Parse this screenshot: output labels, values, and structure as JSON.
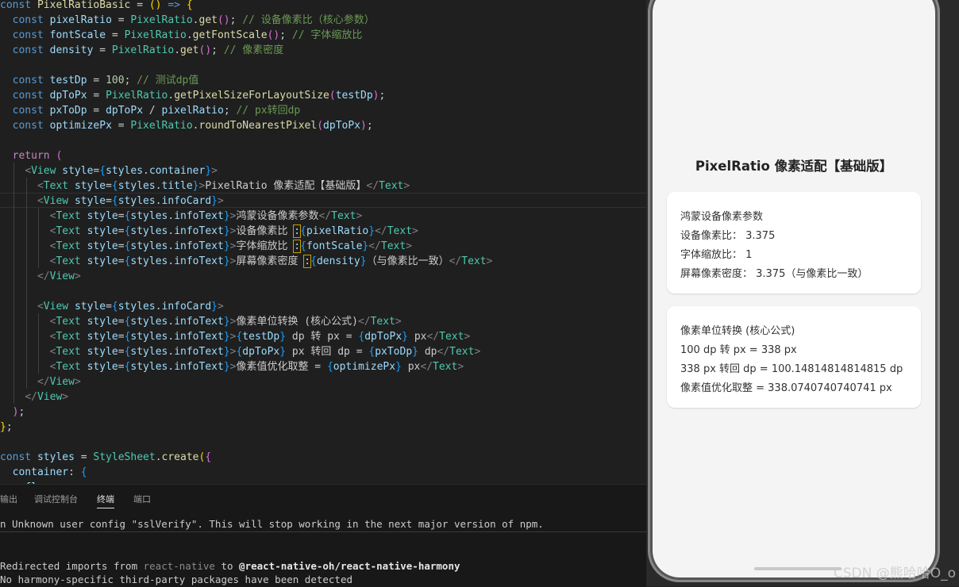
{
  "editor": {
    "lines": [
      [
        [
          "kw",
          "const "
        ],
        [
          "fn",
          "PixelRatioBasic"
        ],
        [
          "str",
          " = "
        ],
        [
          "brace1",
          "() "
        ],
        [
          "kw",
          "=>"
        ],
        [
          "str",
          " "
        ],
        [
          "brace1",
          "{"
        ]
      ],
      [
        [
          "str",
          "  "
        ],
        [
          "kw",
          "const "
        ],
        [
          "var",
          "pixelRatio"
        ],
        [
          "str",
          " = "
        ],
        [
          "cls",
          "PixelRatio"
        ],
        [
          "str",
          "."
        ],
        [
          "fn",
          "get"
        ],
        [
          "brace2",
          "()"
        ],
        [
          "str",
          "; "
        ],
        [
          "cm",
          "// 设备像素比（核心参数）"
        ]
      ],
      [
        [
          "str",
          "  "
        ],
        [
          "kw",
          "const "
        ],
        [
          "var",
          "fontScale"
        ],
        [
          "str",
          " = "
        ],
        [
          "cls",
          "PixelRatio"
        ],
        [
          "str",
          "."
        ],
        [
          "fn",
          "getFontScale"
        ],
        [
          "brace2",
          "()"
        ],
        [
          "str",
          "; "
        ],
        [
          "cm",
          "// 字体缩放比"
        ]
      ],
      [
        [
          "str",
          "  "
        ],
        [
          "kw",
          "const "
        ],
        [
          "var",
          "density"
        ],
        [
          "str",
          " = "
        ],
        [
          "cls",
          "PixelRatio"
        ],
        [
          "str",
          "."
        ],
        [
          "fn",
          "get"
        ],
        [
          "brace2",
          "()"
        ],
        [
          "str",
          "; "
        ],
        [
          "cm",
          "// 像素密度"
        ]
      ],
      [],
      [
        [
          "str",
          "  "
        ],
        [
          "kw",
          "const "
        ],
        [
          "var",
          "testDp"
        ],
        [
          "str",
          " = "
        ],
        [
          "num",
          "100"
        ],
        [
          "str",
          "; "
        ],
        [
          "cm",
          "// 测试dp值"
        ]
      ],
      [
        [
          "str",
          "  "
        ],
        [
          "kw",
          "const "
        ],
        [
          "var",
          "dpToPx"
        ],
        [
          "str",
          " = "
        ],
        [
          "cls",
          "PixelRatio"
        ],
        [
          "str",
          "."
        ],
        [
          "fn",
          "getPixelSizeForLayoutSize"
        ],
        [
          "brace2",
          "("
        ],
        [
          "var",
          "testDp"
        ],
        [
          "brace2",
          ")"
        ],
        [
          "str",
          ";"
        ]
      ],
      [
        [
          "str",
          "  "
        ],
        [
          "kw",
          "const "
        ],
        [
          "var",
          "pxToDp"
        ],
        [
          "str",
          " = "
        ],
        [
          "var",
          "dpToPx"
        ],
        [
          "str",
          " / "
        ],
        [
          "var",
          "pixelRatio"
        ],
        [
          "str",
          "; "
        ],
        [
          "cm",
          "// px转回dp"
        ]
      ],
      [
        [
          "str",
          "  "
        ],
        [
          "kw",
          "const "
        ],
        [
          "var",
          "optimizePx"
        ],
        [
          "str",
          " = "
        ],
        [
          "cls",
          "PixelRatio"
        ],
        [
          "str",
          "."
        ],
        [
          "fn",
          "roundToNearestPixel"
        ],
        [
          "brace2",
          "("
        ],
        [
          "var",
          "dpToPx"
        ],
        [
          "brace2",
          ")"
        ],
        [
          "str",
          ";"
        ]
      ],
      [],
      [
        [
          "str",
          "  "
        ],
        [
          "kw2",
          "return "
        ],
        [
          "brace2",
          "("
        ]
      ],
      [
        [
          "str",
          "    "
        ],
        [
          "tagb",
          "<"
        ],
        [
          "cls",
          "View "
        ],
        [
          "var",
          "style"
        ],
        [
          "str",
          "="
        ],
        [
          "brace3",
          "{"
        ],
        [
          "var",
          "styles"
        ],
        [
          "str",
          "."
        ],
        [
          "var",
          "container"
        ],
        [
          "brace3",
          "}"
        ],
        [
          "tagb",
          ">"
        ]
      ],
      [
        [
          "str",
          "      "
        ],
        [
          "tagb",
          "<"
        ],
        [
          "cls",
          "Text "
        ],
        [
          "var",
          "style"
        ],
        [
          "str",
          "="
        ],
        [
          "brace3",
          "{"
        ],
        [
          "var",
          "styles"
        ],
        [
          "str",
          "."
        ],
        [
          "var",
          "title"
        ],
        [
          "brace3",
          "}"
        ],
        [
          "tagb",
          ">"
        ],
        [
          "str",
          "PixelRatio 像素适配【基础版】"
        ],
        [
          "tagb",
          "</"
        ],
        [
          "cls",
          "Text"
        ],
        [
          "tagb",
          ">"
        ]
      ],
      [
        [
          "str",
          "      "
        ],
        [
          "tagb",
          "<"
        ],
        [
          "cls",
          "View "
        ],
        [
          "var",
          "style"
        ],
        [
          "str",
          "="
        ],
        [
          "brace3",
          "{"
        ],
        [
          "var",
          "styles"
        ],
        [
          "str",
          "."
        ],
        [
          "var",
          "infoCard"
        ],
        [
          "brace3",
          "}"
        ],
        [
          "tagb",
          ">"
        ]
      ],
      [
        [
          "str",
          "        "
        ],
        [
          "tagb",
          "<"
        ],
        [
          "cls",
          "Text "
        ],
        [
          "var",
          "style"
        ],
        [
          "str",
          "="
        ],
        [
          "brace3",
          "{"
        ],
        [
          "var",
          "styles"
        ],
        [
          "str",
          "."
        ],
        [
          "var",
          "infoText"
        ],
        [
          "brace3",
          "}"
        ],
        [
          "tagb",
          ">"
        ],
        [
          "str",
          "鸿蒙设备像素参数"
        ],
        [
          "tagb",
          "</"
        ],
        [
          "cls",
          "Text"
        ],
        [
          "tagb",
          ">"
        ]
      ],
      [
        [
          "str",
          "        "
        ],
        [
          "tagb",
          "<"
        ],
        [
          "cls",
          "Text "
        ],
        [
          "var",
          "style"
        ],
        [
          "str",
          "="
        ],
        [
          "brace3",
          "{"
        ],
        [
          "var",
          "styles"
        ],
        [
          "str",
          "."
        ],
        [
          "var",
          "infoText"
        ],
        [
          "brace3",
          "}"
        ],
        [
          "tagb",
          ">"
        ],
        [
          "str",
          "设备像素比 "
        ],
        [
          "hlc",
          ":"
        ],
        [
          "brace3",
          "{"
        ],
        [
          "var",
          "pixelRatio"
        ],
        [
          "brace3",
          "}"
        ],
        [
          "tagb",
          "</"
        ],
        [
          "cls",
          "Text"
        ],
        [
          "tagb",
          ">"
        ]
      ],
      [
        [
          "str",
          "        "
        ],
        [
          "tagb",
          "<"
        ],
        [
          "cls",
          "Text "
        ],
        [
          "var",
          "style"
        ],
        [
          "str",
          "="
        ],
        [
          "brace3",
          "{"
        ],
        [
          "var",
          "styles"
        ],
        [
          "str",
          "."
        ],
        [
          "var",
          "infoText"
        ],
        [
          "brace3",
          "}"
        ],
        [
          "tagb",
          ">"
        ],
        [
          "str",
          "字体缩放比 "
        ],
        [
          "hlc",
          ":"
        ],
        [
          "brace3",
          "{"
        ],
        [
          "var",
          "fontScale"
        ],
        [
          "brace3",
          "}"
        ],
        [
          "tagb",
          "</"
        ],
        [
          "cls",
          "Text"
        ],
        [
          "tagb",
          ">"
        ]
      ],
      [
        [
          "str",
          "        "
        ],
        [
          "tagb",
          "<"
        ],
        [
          "cls",
          "Text "
        ],
        [
          "var",
          "style"
        ],
        [
          "str",
          "="
        ],
        [
          "brace3",
          "{"
        ],
        [
          "var",
          "styles"
        ],
        [
          "str",
          "."
        ],
        [
          "var",
          "infoText"
        ],
        [
          "brace3",
          "}"
        ],
        [
          "tagb",
          ">"
        ],
        [
          "str",
          "屏幕像素密度 "
        ],
        [
          "hlc",
          ":"
        ],
        [
          "brace3",
          "{"
        ],
        [
          "var",
          "density"
        ],
        [
          "brace3",
          "}"
        ],
        [
          "str",
          "（与像素比一致）"
        ],
        [
          "tagb",
          "</"
        ],
        [
          "cls",
          "Text"
        ],
        [
          "tagb",
          ">"
        ]
      ],
      [
        [
          "str",
          "      "
        ],
        [
          "tagb",
          "</"
        ],
        [
          "cls",
          "View"
        ],
        [
          "tagb",
          ">"
        ]
      ],
      [],
      [
        [
          "str",
          "      "
        ],
        [
          "tagb",
          "<"
        ],
        [
          "cls",
          "View "
        ],
        [
          "var",
          "style"
        ],
        [
          "str",
          "="
        ],
        [
          "brace3",
          "{"
        ],
        [
          "var",
          "styles"
        ],
        [
          "str",
          "."
        ],
        [
          "var",
          "infoCard"
        ],
        [
          "brace3",
          "}"
        ],
        [
          "tagb",
          ">"
        ]
      ],
      [
        [
          "str",
          "        "
        ],
        [
          "tagb",
          "<"
        ],
        [
          "cls",
          "Text "
        ],
        [
          "var",
          "style"
        ],
        [
          "str",
          "="
        ],
        [
          "brace3",
          "{"
        ],
        [
          "var",
          "styles"
        ],
        [
          "str",
          "."
        ],
        [
          "var",
          "infoText"
        ],
        [
          "brace3",
          "}"
        ],
        [
          "tagb",
          ">"
        ],
        [
          "str",
          "像素单位转换 (核心公式)"
        ],
        [
          "tagb",
          "</"
        ],
        [
          "cls",
          "Text"
        ],
        [
          "tagb",
          ">"
        ]
      ],
      [
        [
          "str",
          "        "
        ],
        [
          "tagb",
          "<"
        ],
        [
          "cls",
          "Text "
        ],
        [
          "var",
          "style"
        ],
        [
          "str",
          "="
        ],
        [
          "brace3",
          "{"
        ],
        [
          "var",
          "styles"
        ],
        [
          "str",
          "."
        ],
        [
          "var",
          "infoText"
        ],
        [
          "brace3",
          "}"
        ],
        [
          "tagb",
          ">"
        ],
        [
          "brace3",
          "{"
        ],
        [
          "var",
          "testDp"
        ],
        [
          "brace3",
          "}"
        ],
        [
          "str",
          " dp 转 px = "
        ],
        [
          "brace3",
          "{"
        ],
        [
          "var",
          "dpToPx"
        ],
        [
          "brace3",
          "}"
        ],
        [
          "str",
          " px"
        ],
        [
          "tagb",
          "</"
        ],
        [
          "cls",
          "Text"
        ],
        [
          "tagb",
          ">"
        ]
      ],
      [
        [
          "str",
          "        "
        ],
        [
          "tagb",
          "<"
        ],
        [
          "cls",
          "Text "
        ],
        [
          "var",
          "style"
        ],
        [
          "str",
          "="
        ],
        [
          "brace3",
          "{"
        ],
        [
          "var",
          "styles"
        ],
        [
          "str",
          "."
        ],
        [
          "var",
          "infoText"
        ],
        [
          "brace3",
          "}"
        ],
        [
          "tagb",
          ">"
        ],
        [
          "brace3",
          "{"
        ],
        [
          "var",
          "dpToPx"
        ],
        [
          "brace3",
          "}"
        ],
        [
          "str",
          " px 转回 dp = "
        ],
        [
          "brace3",
          "{"
        ],
        [
          "var",
          "pxToDp"
        ],
        [
          "brace3",
          "}"
        ],
        [
          "str",
          " dp"
        ],
        [
          "tagb",
          "</"
        ],
        [
          "cls",
          "Text"
        ],
        [
          "tagb",
          ">"
        ]
      ],
      [
        [
          "str",
          "        "
        ],
        [
          "tagb",
          "<"
        ],
        [
          "cls",
          "Text "
        ],
        [
          "var",
          "style"
        ],
        [
          "str",
          "="
        ],
        [
          "brace3",
          "{"
        ],
        [
          "var",
          "styles"
        ],
        [
          "str",
          "."
        ],
        [
          "var",
          "infoText"
        ],
        [
          "brace3",
          "}"
        ],
        [
          "tagb",
          ">"
        ],
        [
          "str",
          "像素值优化取整 = "
        ],
        [
          "brace3",
          "{"
        ],
        [
          "var",
          "optimizePx"
        ],
        [
          "brace3",
          "}"
        ],
        [
          "str",
          " px"
        ],
        [
          "tagb",
          "</"
        ],
        [
          "cls",
          "Text"
        ],
        [
          "tagb",
          ">"
        ]
      ],
      [
        [
          "str",
          "      "
        ],
        [
          "tagb",
          "</"
        ],
        [
          "cls",
          "View"
        ],
        [
          "tagb",
          ">"
        ]
      ],
      [
        [
          "str",
          "    "
        ],
        [
          "tagb",
          "</"
        ],
        [
          "cls",
          "View"
        ],
        [
          "tagb",
          ">"
        ]
      ],
      [
        [
          "str",
          "  "
        ],
        [
          "brace2",
          ")"
        ],
        [
          "str",
          ";"
        ]
      ],
      [
        [
          "brace1",
          "}"
        ],
        [
          "str",
          ";"
        ]
      ],
      [],
      [
        [
          "kw",
          "const "
        ],
        [
          "var",
          "styles"
        ],
        [
          "str",
          " = "
        ],
        [
          "cls",
          "StyleSheet"
        ],
        [
          "str",
          "."
        ],
        [
          "fn",
          "create"
        ],
        [
          "brace1",
          "("
        ],
        [
          "brace2",
          "{"
        ]
      ],
      [
        [
          "str",
          "  "
        ],
        [
          "var",
          "container"
        ],
        [
          "str",
          ": "
        ],
        [
          "brace3",
          "{"
        ]
      ],
      [
        [
          "str",
          "    "
        ],
        [
          "var",
          "fl"
        ]
      ]
    ]
  },
  "panel": {
    "tabs": [
      "输出",
      "调试控制台",
      "终端",
      "端口"
    ],
    "active_tab": "终端",
    "warning_line": "n Unknown user config \"sslVerify\". This will stop working in the next major version of npm.",
    "redirect_prefix": "Redirected imports from ",
    "redirect_from": "react-native",
    "redirect_mid": " to ",
    "redirect_to": "@react-native-oh/react-native-harmony",
    "harmony_line": "No harmony-specific third-party packages have been detected"
  },
  "app": {
    "title": "PixelRatio 像素适配【基础版】",
    "card1": {
      "heading": "鸿蒙设备像素参数",
      "line1": "设备像素比： 3.375",
      "line2": "字体缩放比： 1",
      "line3": "屏幕像素密度： 3.375（与像素比一致）"
    },
    "card2": {
      "heading": "像素单位转换 (核心公式)",
      "line1": "100 dp 转 px = 338 px",
      "line2": "338 px 转回 dp = 100.14814814814815 dp",
      "line3": "像素值优化取整 = 338.0740740740741 px"
    }
  },
  "watermark": "CSDN @熊哈哈O_o"
}
